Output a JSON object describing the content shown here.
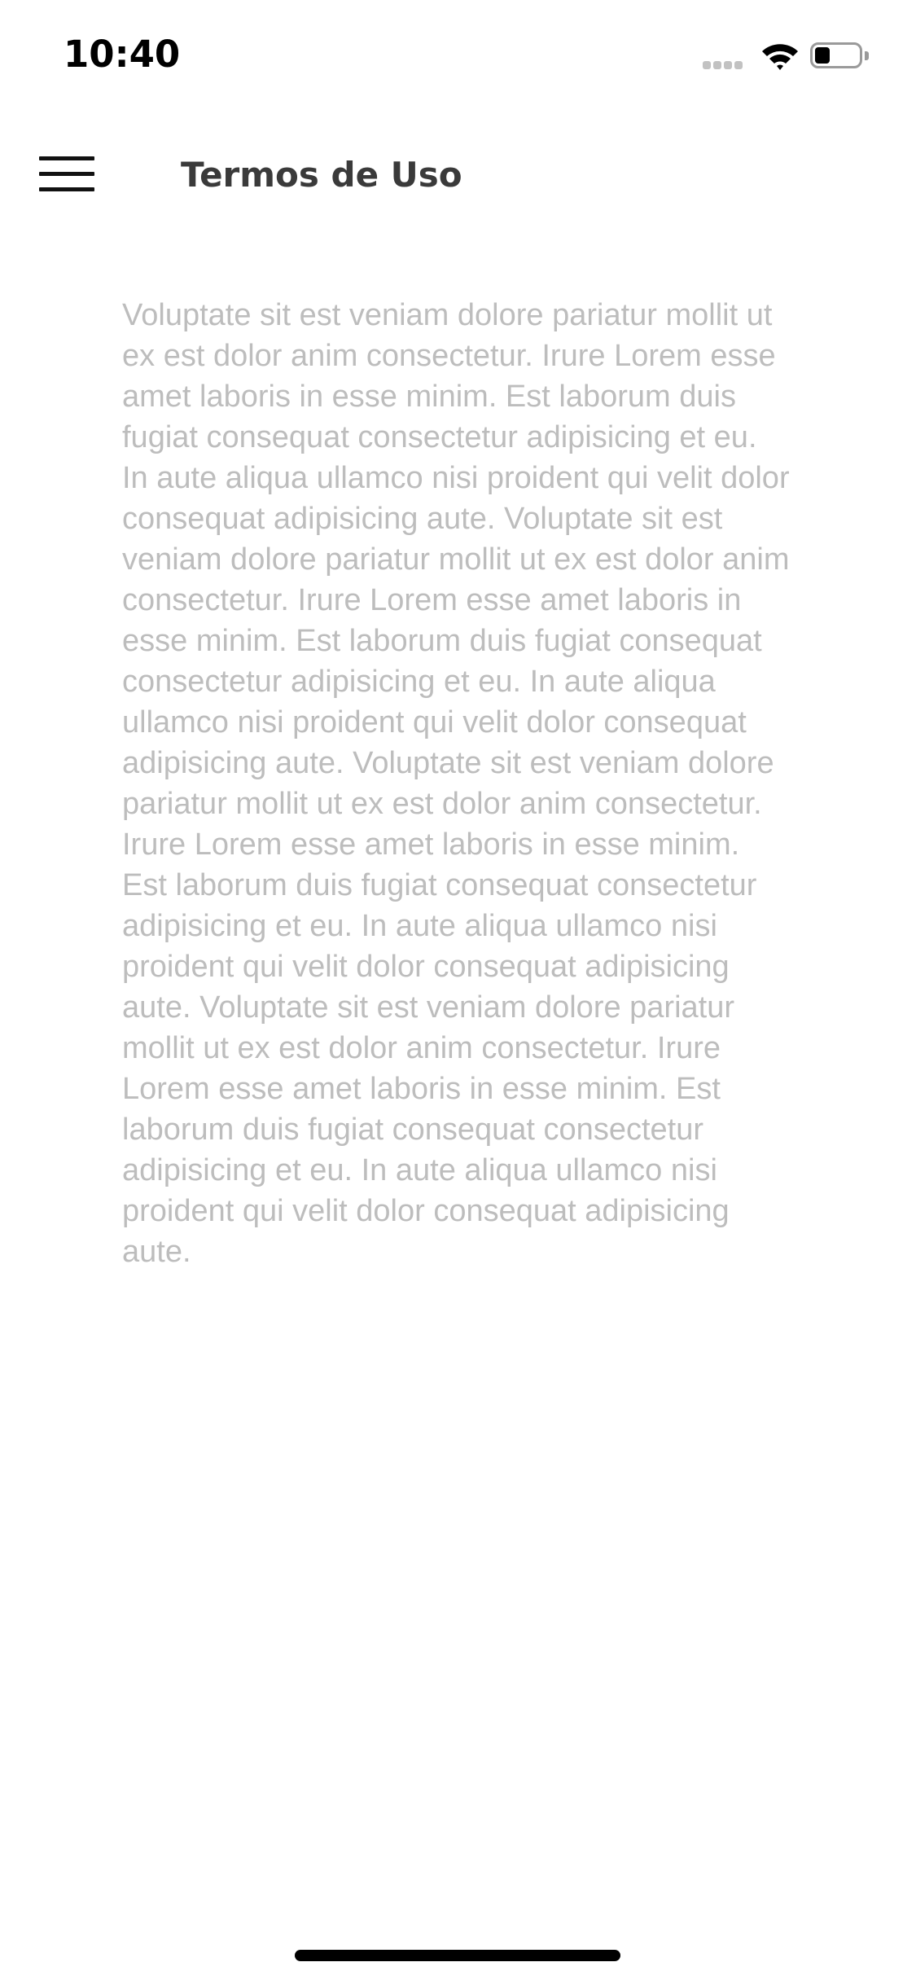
{
  "status_bar": {
    "time": "10:40",
    "icons": [
      "signal-icon",
      "wifi-icon",
      "battery-icon"
    ],
    "battery_level": 0.35
  },
  "header": {
    "title": "Termos de Uso",
    "menu_icon": "hamburger-menu-icon"
  },
  "content": {
    "body": "Voluptate sit est veniam dolore pariatur mollit ut ex est dolor anim consectetur. Irure Lorem esse amet laboris in esse minim. Est laborum duis fugiat consequat consectetur adipisicing et eu. In aute aliqua ullamco nisi proident qui velit dolor consequat adipisicing aute. Voluptate sit est veniam dolore pariatur mollit ut ex est dolor anim consectetur. Irure Lorem esse amet laboris in esse minim. Est laborum duis fugiat consequat consectetur adipisicing et eu. In aute aliqua ullamco nisi proident qui velit dolor consequat adipisicing aute. Voluptate sit est veniam dolore pariatur mollit ut ex est dolor anim consectetur. Irure Lorem esse amet laboris in esse minim. Est laborum duis fugiat consequat consectetur adipisicing et eu. In aute aliqua ullamco nisi proident qui velit dolor consequat adipisicing aute. Voluptate sit est veniam dolore pariatur mollit ut ex est dolor anim consectetur. Irure Lorem esse amet laboris in esse minim. Est laborum duis fugiat consequat consectetur adipisicing et eu. In aute aliqua ullamco nisi proident qui velit dolor consequat adipisicing aute."
  },
  "colors": {
    "background": "#ffffff",
    "title_text": "#3a3a3a",
    "body_text": "#bdbdbd",
    "icon": "#111111"
  }
}
